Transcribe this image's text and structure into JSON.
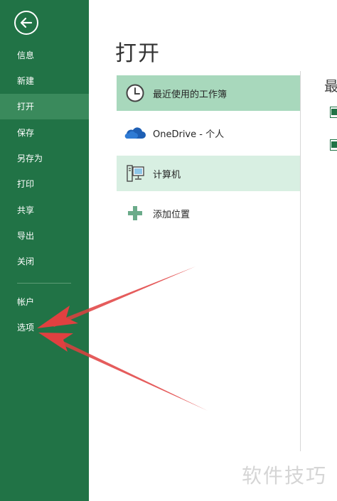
{
  "sidebar": {
    "items": [
      {
        "label": "信息"
      },
      {
        "label": "新建"
      },
      {
        "label": "打开"
      },
      {
        "label": "保存"
      },
      {
        "label": "另存为"
      },
      {
        "label": "打印"
      },
      {
        "label": "共享"
      },
      {
        "label": "导出"
      },
      {
        "label": "关闭"
      },
      {
        "label": "帐户"
      },
      {
        "label": "选项"
      }
    ],
    "active": "打开"
  },
  "main": {
    "title": "打开",
    "locations": [
      {
        "label": "最近使用的工作簿",
        "icon": "clock-icon",
        "state": "selected"
      },
      {
        "label": "OneDrive - 个人",
        "icon": "cloud-icon",
        "state": "normal"
      },
      {
        "label": "计算机",
        "icon": "computer-icon",
        "state": "hover"
      },
      {
        "label": "添加位置",
        "icon": "plus-icon",
        "state": "normal"
      }
    ],
    "recent_panel_title": "最"
  },
  "watermark": "软件技巧",
  "colors": {
    "sidebar": "#217346",
    "sidebar_active": "#3a8a5c",
    "selected": "#a8d8bc",
    "hover": "#d8efe2",
    "annotation_arrow": "#e04040"
  }
}
